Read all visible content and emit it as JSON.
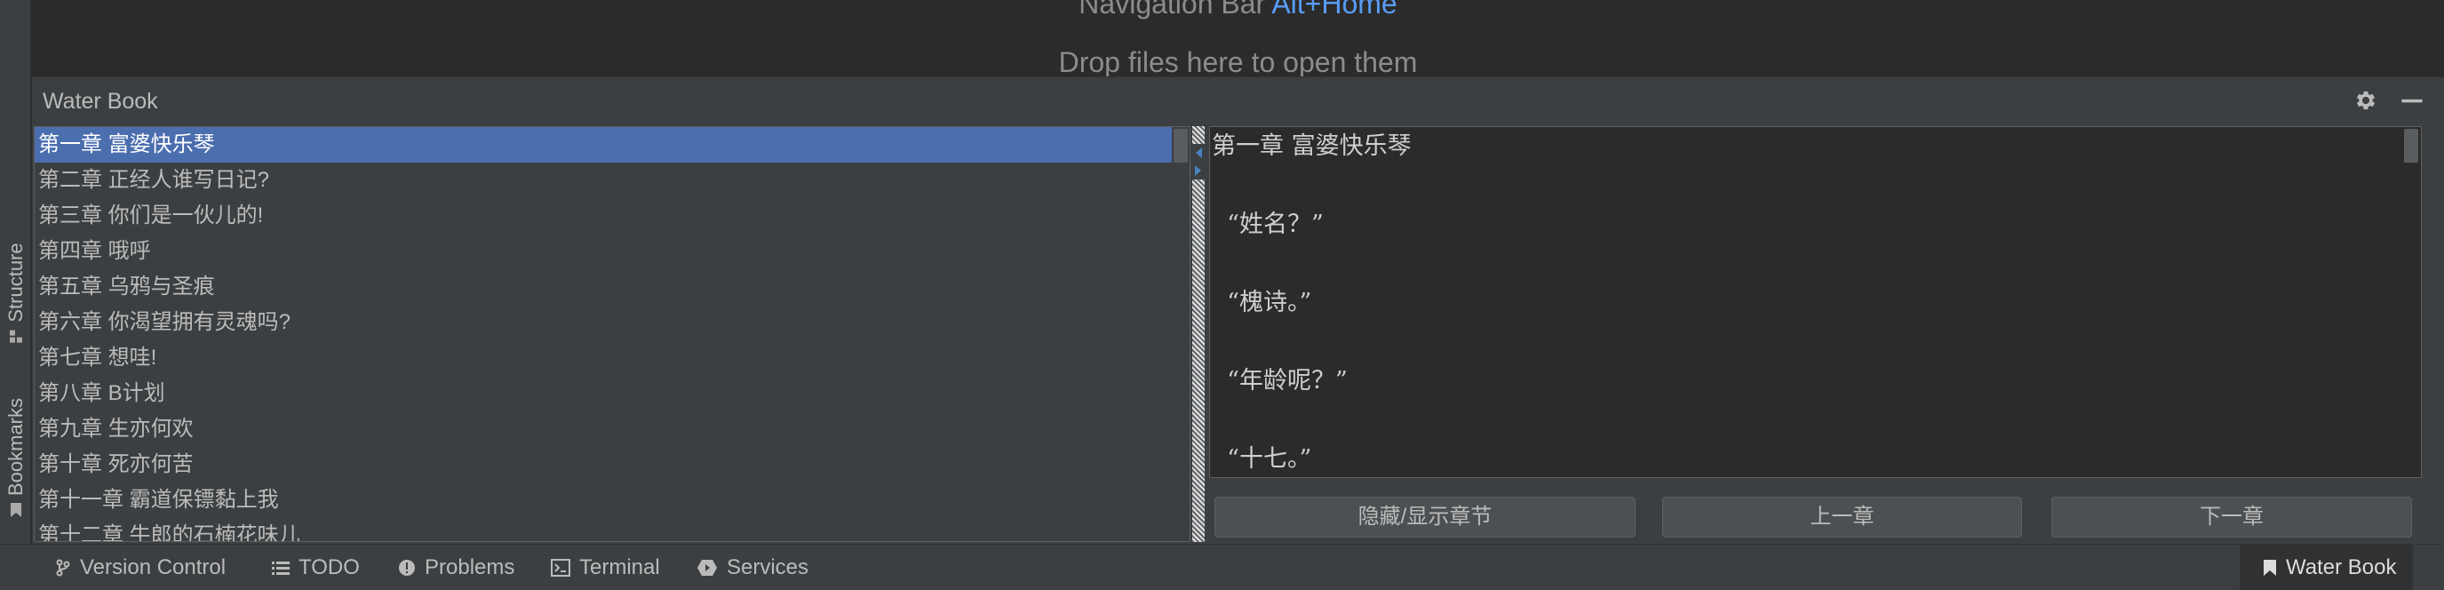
{
  "editor_empty": {
    "nav_hint_prefix": "Navigation Bar",
    "nav_hint_shortcut": "Alt+Home",
    "drop_hint": "Drop files here to open them"
  },
  "left_strip": {
    "structure_label": "Structure",
    "bookmarks_label": "Bookmarks"
  },
  "tool_window": {
    "title": "Water Book",
    "chapters": [
      "第一章 富婆快乐琴",
      "第二章 正经人谁写日记?",
      "第三章 你们是一伙儿的!",
      "第四章 哦呼",
      "第五章 乌鸦与圣痕",
      "第六章 你渴望拥有灵魂吗?",
      "第七章 想哇!",
      "第八章 B计划",
      "第九章 生亦何欢",
      "第十章 死亦何苦",
      "第十一章 霸道保镖黏上我",
      "第十二章 牛郎的石楠花味儿"
    ],
    "selected_index": 0,
    "content_lines": [
      "第一章 富婆快乐琴",
      "",
      "  “姓名？”",
      "",
      "  “槐诗。”",
      "",
      "  “年龄呢？”",
      "",
      "  “十七。”"
    ],
    "buttons": {
      "toggle": "隐藏/显示章节",
      "prev": "上一章",
      "next": "下一章"
    }
  },
  "bottom_bar": {
    "version_control": "Version Control",
    "todo": "TODO",
    "problems": "Problems",
    "terminal": "Terminal",
    "services": "Services",
    "water_book": "Water Book"
  },
  "colors": {
    "selection": "#4b6eaf",
    "shortcut": "#589df6",
    "background": "#3c3f41",
    "editor_bg": "#2b2b2b"
  }
}
